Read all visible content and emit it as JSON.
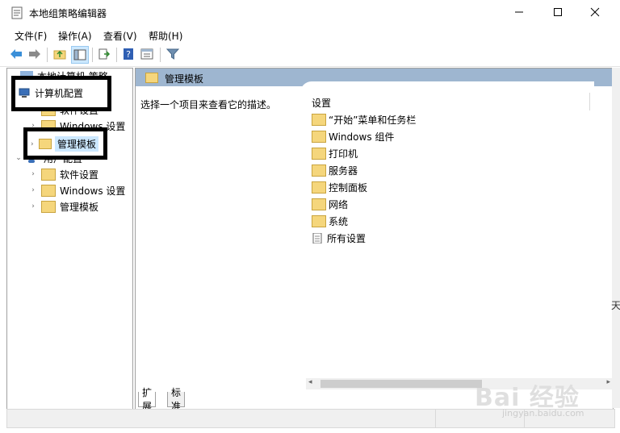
{
  "window": {
    "title": "本地组策略编辑器"
  },
  "menu": {
    "file": "文件(F)",
    "action": "操作(A)",
    "view": "查看(V)",
    "help": "帮助(H)"
  },
  "tree": {
    "root": "本地计算机 策略",
    "computer_config": "计算机配置",
    "software_settings": "软件设置",
    "windows_settings": "Windows 设置",
    "admin_templates": "管理模板",
    "user_config": "用户配置",
    "user_software_settings": "软件设置",
    "user_windows_settings": "Windows 设置",
    "user_admin_templates": "管理模板"
  },
  "content": {
    "header": "管理模板",
    "description": "选择一个项目来查看它的描述。",
    "column_header": "设置",
    "items": [
      "“开始”菜单和任务栏",
      "Windows 组件",
      "打印机",
      "服务器",
      "控制面板",
      "网络",
      "系统",
      "所有设置"
    ]
  },
  "tabs": {
    "extended": "扩展",
    "standard": "标准"
  },
  "edge_fragment": "天",
  "watermark": {
    "brand": "Bai 经验",
    "url": "jingyan.baidu.com"
  },
  "colors": {
    "header_bar": "#9eb6d0",
    "selection": "#cce8ff",
    "folder": "#f5d67c",
    "annotation_box": "#000000"
  }
}
